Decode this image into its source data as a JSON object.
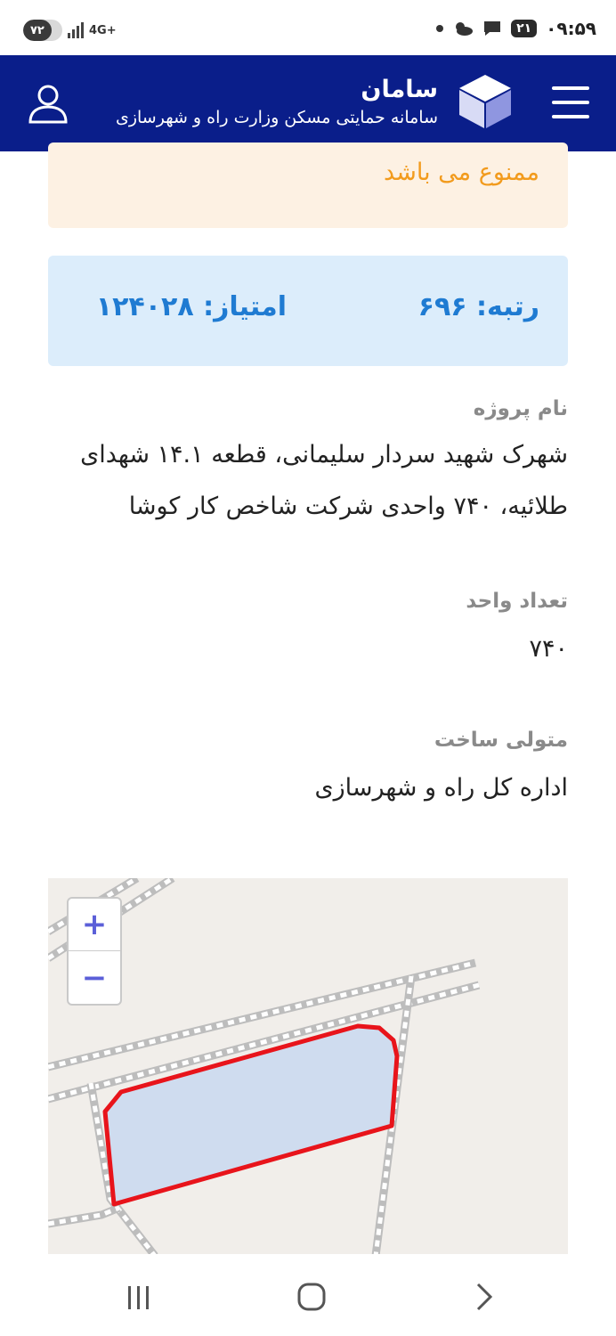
{
  "status_bar": {
    "time": "۰۹:۵۹",
    "notification_badge": "۲۱",
    "battery": "۷۲",
    "network": "4G+"
  },
  "header": {
    "app_name": "سامان",
    "subtitle": "سامانه حمایتی مسکن وزارت راه و شهرسازی"
  },
  "alert": {
    "text": "ممنوع می باشد"
  },
  "ranking": {
    "rank": "رتبه: ۶۹۶",
    "score": "امتیاز: ۱۲۴۰۲۸"
  },
  "details": {
    "project_label": "نام پروژه",
    "project_line1": "شهرک شهید سردار سلیمانی، قطعه ۱۴.۱ شهدای",
    "project_line2": "طلائیه، ۷۴۰ واحدی شرکت شاخص کار کوشا",
    "units_label": "تعداد واحد",
    "units_value": "۷۴۰",
    "developer_label": "متولی ساخت",
    "developer_value": "اداره کل راه و شهرسازی"
  },
  "map": {
    "zoom_in": "+",
    "zoom_out": "−",
    "parcel_stroke": "#e8141b",
    "parcel_fill": "#cfdcef"
  },
  "colors": {
    "header_bg": "#0a1e8a",
    "alert_bg": "#fdf1e3",
    "alert_text": "#f29b1d",
    "rank_bg": "#dcedfb",
    "rank_text": "#1f7bd2"
  }
}
